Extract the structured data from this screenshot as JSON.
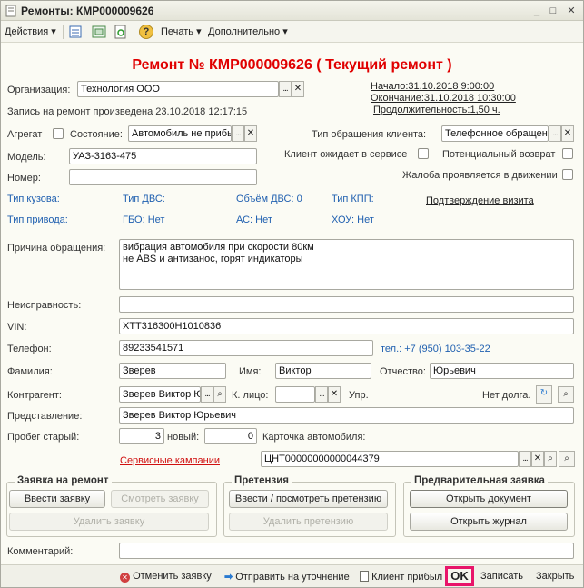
{
  "window": {
    "title": "Ремонты: КМР000009626"
  },
  "toolbar": {
    "actions": "Действия",
    "help": "?",
    "print": "Печать",
    "more": "Дополнительно"
  },
  "heading": "Ремонт № КМР000009626 ( Текущий ремонт )",
  "org": {
    "label": "Организация:",
    "value": "Технология ООО"
  },
  "dates": {
    "start": "Начало:31.10.2018 9:00:00",
    "end": "Окончание:31.10.2018 10:30:00",
    "duration": "Продолжительность:1,50 ч."
  },
  "record_made": "Запись на ремонт произведена 23.10.2018 12:17:15",
  "aggregate_label": "Агрегат",
  "state": {
    "label": "Состояние:",
    "value": "Автомобиль не прибыл"
  },
  "appeal_type": {
    "label": "Тип обращения клиента:",
    "value": "Телефонное обращение"
  },
  "model": {
    "label": "Модель:",
    "value": "УАЗ-3163-475"
  },
  "client_waits_label": "Клиент ожидает в сервисе",
  "potential_return_label": "Потенциальный возврат",
  "number_label": "Номер:",
  "complaint_motion_label": "Жалоба проявляется в движении",
  "info": {
    "body_type": "Тип кузова:",
    "engine_type": "Тип ДВС:",
    "engine_volume": "Объём ДВС: 0",
    "gearbox": "Тип КПП:",
    "confirm_visit": "Подтверждение визита",
    "drive_type": "Тип привода:",
    "gbo": "ГБО: Нет",
    "ac": "АС: Нет",
    "chassis": "ХОУ: Нет"
  },
  "reason": {
    "label": "Причина обращения:",
    "line1": "вибрация автомобиля при скорости 80км",
    "line2": "не ABS и антизанос, горят индикаторы"
  },
  "malfunction_label": "Неисправность:",
  "vin": {
    "label": "VIN:",
    "value": "XTT316300H1010836"
  },
  "phone": {
    "label": "Телефон:",
    "value": "89233541571",
    "extra": "тел.: +7 (950) 103-35-22"
  },
  "surname": {
    "label": "Фамилия:",
    "value": "Зверев"
  },
  "name": {
    "label": "Имя:",
    "value": "Виктор"
  },
  "patronymic": {
    "label": "Отчество:",
    "value": "Юрьевич"
  },
  "counterparty": {
    "label": "Контрагент:",
    "value": "Зверев Виктор Юрьевич"
  },
  "contact_person_label": "К. лицо:",
  "manager_label": "Упр.",
  "no_debt": "Нет долга.",
  "representation": {
    "label": "Представление:",
    "value": "Зверев Виктор Юрьевич"
  },
  "mileage": {
    "label": "Пробег старый:",
    "old": "3",
    "new_label": "новый:",
    "new": "0"
  },
  "car_card_label": "Карточка автомобиля:",
  "service_campaigns": "Сервисные кампании",
  "car_card_value": "ЦНТ00000000000044379",
  "groups": {
    "request": {
      "title": "Заявка на ремонт",
      "enter": "Ввести заявку",
      "view": "Смотреть заявку",
      "delete": "Удалить заявку"
    },
    "claim": {
      "title": "Претензия",
      "enter": "Ввести / посмотреть претензию",
      "delete": "Удалить претензию"
    },
    "prelim": {
      "title": "Предварительная заявка",
      "open_doc": "Открыть документ",
      "open_journal": "Открыть журнал"
    }
  },
  "comment_label": "Комментарий:",
  "bottom": {
    "cancel": "Отменить заявку",
    "send": "Отправить на уточнение",
    "arrived": "Клиент прибыл",
    "ok": "OK",
    "save": "Записать",
    "close": "Закрыть"
  },
  "colors": {
    "heading": "#e00000",
    "ok_highlight": "#e8156a",
    "info_blue": "#2060b0"
  }
}
